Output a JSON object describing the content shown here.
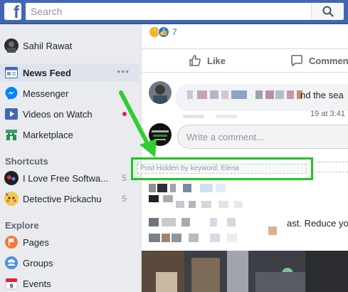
{
  "topbar": {
    "search_placeholder": "Search"
  },
  "sidebar": {
    "profile_name": "Sahil Rawat",
    "news_feed": "News Feed",
    "messenger": "Messenger",
    "videos": "Videos on Watch",
    "marketplace": "Marketplace",
    "shortcuts_heading": "Shortcuts",
    "shortcuts": [
      {
        "label": "I Love Free Softwa...",
        "count": "5"
      },
      {
        "label": "Detective Pickachu",
        "count": "5"
      }
    ],
    "explore_heading": "Explore",
    "explore": [
      {
        "label": "Pages"
      },
      {
        "label": "Groups"
      },
      {
        "label": "Events"
      }
    ],
    "events_badge": "9"
  },
  "feed": {
    "reaction_count": "7",
    "like_label": "Like",
    "comment_label": "Comment",
    "comment1_text_fragment": "nd the sea",
    "comment1_time_fragment": "19 at 3:41",
    "write_comment_placeholder": "Write a comment...",
    "hidden_post_text": "Post Hidden by keyword: Elena",
    "post_text_fragment": "ast. Reduce yo"
  },
  "colors": {
    "brand_blue": "#4267b2",
    "highlight_green": "#22c322",
    "notification_red": "#e41e3f"
  }
}
